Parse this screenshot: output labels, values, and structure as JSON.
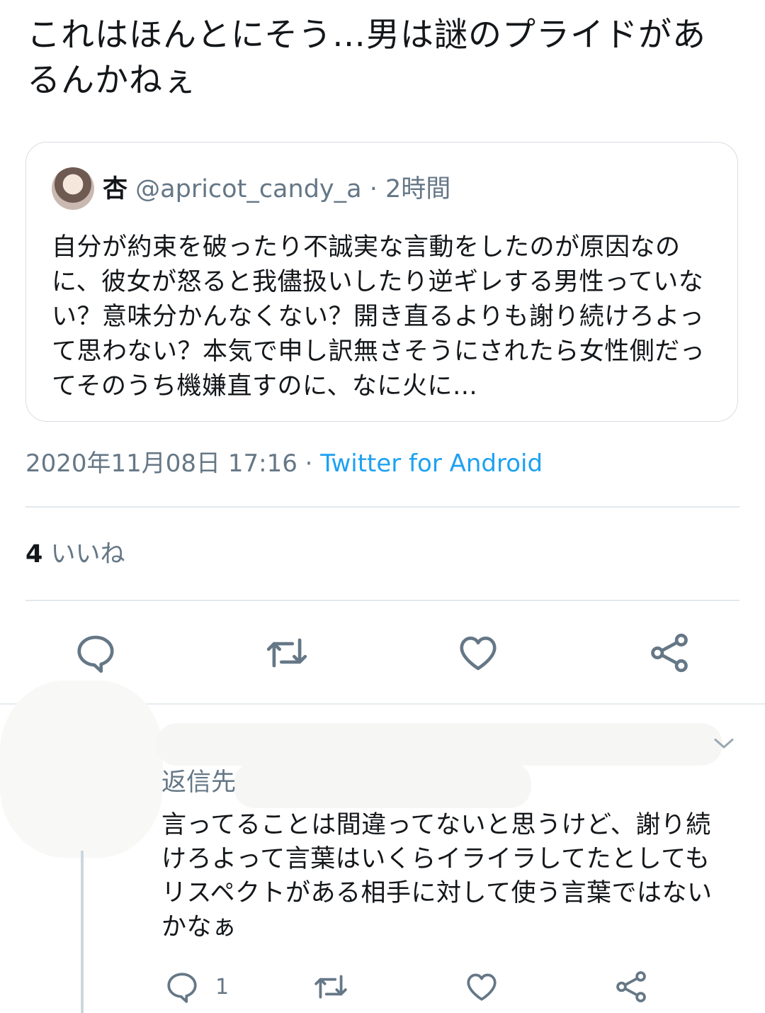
{
  "tweet": {
    "text": "これはほんとにそう…男は謎のプライドがあるんかねぇ",
    "quoted": {
      "name": "杏",
      "handle": "@apricot_candy_a",
      "dot": " · ",
      "time": "2時間",
      "text": "自分が約束を破ったり不誠実な言動をしたのが原因なのに、彼女が怒ると我儘扱いしたり逆ギレする男性っていない？意味分かんなくない？開き直るよりも謝り続けろよって思わない？本気で申し訳無さそうにされたら女性側だってそのうち機嫌直すのに、なに火に…"
    },
    "date": "2020年11月08日 17:16",
    "meta_dot": " · ",
    "source": "Twitter for Android",
    "likes_count": "4",
    "likes_label": "いいね"
  },
  "actions": {
    "reply_icon": "reply-bubble-icon",
    "retweet_icon": "retweet-icon",
    "like_icon": "heart-icon",
    "share_icon": "share-icon"
  },
  "reply": {
    "reply_to_label": "返信先",
    "text": "言ってることは間違ってないと思うけど、謝り続けろよって言葉はいくらイライラしてたとしてもリスペクトがある相手に対して使う言葉ではないかなぁ",
    "reply_count": "1"
  },
  "colors": {
    "accent": "#1da1f2",
    "secondary_text": "#657786",
    "icon": "#657786"
  }
}
